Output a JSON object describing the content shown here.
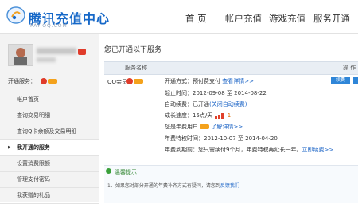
{
  "header": {
    "logo_title": "腾讯充值中心",
    "logo_sub": "PAY.QQ.COM",
    "nav": [
      "首 页",
      "帐户充值",
      "游戏充值",
      "服务开通"
    ]
  },
  "sidebar": {
    "opened_label": "开通服务：",
    "items": [
      {
        "label": "帐户首页",
        "active": false
      },
      {
        "label": "查询交易明细",
        "active": false
      },
      {
        "label": "查询Q卡余额及交易明细",
        "active": false
      },
      {
        "label": "我开通的服务",
        "active": true
      },
      {
        "label": "设置消费限额",
        "active": false
      },
      {
        "label": "管理支付密码",
        "active": false
      },
      {
        "label": "我获赠的礼品",
        "active": false
      }
    ]
  },
  "main": {
    "title": "您已开通以下服务",
    "table_headers": {
      "service": "服务名称",
      "action": "操 作"
    },
    "service_name": "QQ会员",
    "details": {
      "pay_label": "开通方式：",
      "pay_value": "预付费支付",
      "pay_link": "查看详情>>",
      "period_label": "起止时间：",
      "period_value": "2012-09-08 至 2014-08-22",
      "auto_label": "自动续费：",
      "auto_value": "已开通",
      "auto_link": "(关闭自动续费)",
      "growth_label": "成长速度：",
      "growth_value": "15点/天",
      "growth_level": "1",
      "year_label": "您是年费用户",
      "year_link": "了解详情>>",
      "year_time_label": "年费特权时间：",
      "year_time_value": "2012-10-07 至 2014-04-20",
      "renew_label": "年费到期前：",
      "renew_text": "您只需续付9个月，年费特权再延长一年。",
      "renew_link": "立即续费>>"
    },
    "renew_button": "续费",
    "tip_title": "温馨提示",
    "tip_text": "1、如果您对部分开通的年费补齐方式有疑问，请您到",
    "tip_link": "反馈我们"
  }
}
